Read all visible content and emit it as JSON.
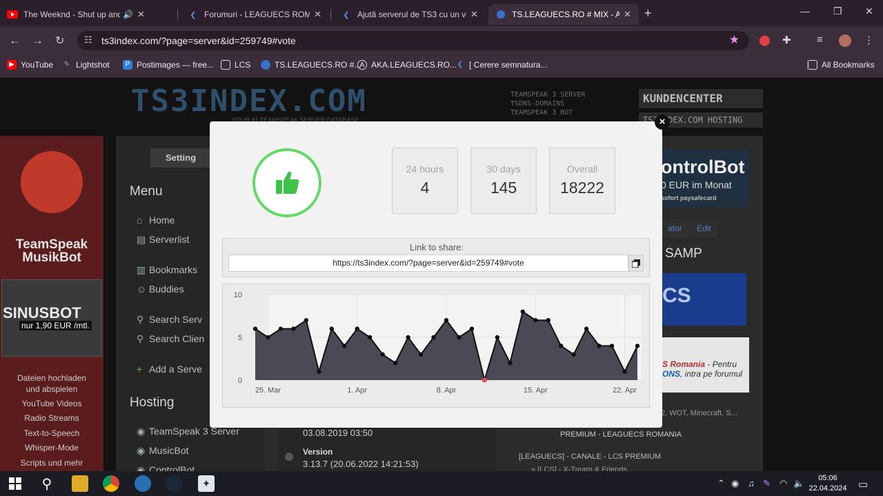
{
  "tabs": [
    {
      "title": "The Weeknd - Shut up and",
      "favicon": "youtube-icon"
    },
    {
      "title": "Forumuri - LEAGUECS ROMAN",
      "favicon": "forum-icon"
    },
    {
      "title": "Ajută serverul de TS3 cu un vo",
      "favicon": "forum-icon"
    },
    {
      "title": "TS.LEAGUECS.RO # MIX - AREA",
      "favicon": "globe-icon"
    }
  ],
  "address_bar": {
    "url": "ts3index.com/?page=server&id=259749#vote"
  },
  "bookmarks": [
    {
      "label": "YouTube"
    },
    {
      "label": "Lightshot"
    },
    {
      "label": "Postimages — free..."
    },
    {
      "label": "LCS"
    },
    {
      "label": "TS.LEAGUECS.RO #..."
    },
    {
      "label": "AKA.LEAGUECS.RO..."
    },
    {
      "label": "[ Cerere semnatura..."
    }
  ],
  "all_bookmarks": "All Bookmarks",
  "site": {
    "logo": "TS3INDEX.COM",
    "tagline": "YOUR #1 TEAMSPEAK SERVER DATABASE",
    "header_services": [
      "TEAMSPEAK 3 SERVER",
      "TSDNS-DOMAINS",
      "TEAMSPEAK 3 BOT"
    ],
    "kundencenter": "KUNDENCENTER",
    "hosting": "TS3INDEX.COM HOSTING"
  },
  "left_ad": {
    "brand_line1": "TeamSpeak",
    "brand_line2": "MusikBot",
    "product": "SINUSBOT",
    "price": "nur 1,90 EUR /mtl.",
    "features": [
      "Dateien hochladen",
      "und abspielen",
      "YouTube Videos",
      "Radio Streams",
      "Text-to-Speech",
      "Whisper-Mode",
      "Scripts und mehr"
    ]
  },
  "sidebar": {
    "settings": "Setting",
    "menu_title": "Menu",
    "menu_items": [
      "Home",
      "Serverlist",
      "Bookmarks",
      "Buddies",
      "Search Serv",
      "Search Clien",
      "Add a Serve"
    ],
    "hosting_title": "Hosting",
    "hosting_items": [
      "TeamSpeak 3 Server",
      "MusicBot",
      "ControlBot"
    ]
  },
  "server_info": {
    "date": "03.08.2019 03:50",
    "version_label": "Version",
    "version_value": "3.13.7 (20.06.2022 14:21:53)"
  },
  "right_col": {
    "ad_title": "ontrolBot",
    "ad_sub": "0 EUR  im Monat",
    "ad_pay": "sofort  paysafecard",
    "tab_admin": "ator",
    "tab_edit": "Edit",
    "samp": "SAMP",
    "banner": "CS",
    "promo_line1_red": "S Romania",
    "promo_line1_rest": " - Pentru",
    "promo_line2_blue": "ONS",
    "promo_line2_rest": ", intra pe forumul",
    "games": "2, WOT, Minecraft, S...",
    "premium": "PREMIUM - LEAGUECS ROMANIA",
    "canale": "[LEAGUECS] - CANALE -  LCS PREMIUM",
    "canale_sub": "» [LCS] - X-Tream & Friends"
  },
  "vote_modal": {
    "stats": [
      {
        "label": "24 hours",
        "value": "4"
      },
      {
        "label": "30 days",
        "value": "145"
      },
      {
        "label": "Overall",
        "value": "18222"
      }
    ],
    "share_label": "Link to share:",
    "share_url": "https://ts3index.com/?page=server&id=259749#vote",
    "colors": {
      "vote_green": "#63d96a",
      "chart_fill": "#4a4a57",
      "highlight_point": "#e05050"
    }
  },
  "chart_data": {
    "type": "area",
    "title": "",
    "xlabel": "",
    "ylabel": "",
    "ylim": [
      0,
      10
    ],
    "yticks": [
      0,
      5,
      10
    ],
    "x_tick_labels": [
      "25. Mar",
      "1. Apr",
      "8. Apr",
      "15. Apr",
      "22. Apr"
    ],
    "x": [
      "24. Mar",
      "25. Mar",
      "26. Mar",
      "27. Mar",
      "28. Mar",
      "29. Mar",
      "30. Mar",
      "31. Mar",
      "1. Apr",
      "2. Apr",
      "3. Apr",
      "4. Apr",
      "5. Apr",
      "6. Apr",
      "7. Apr",
      "8. Apr",
      "9. Apr",
      "10. Apr",
      "11. Apr",
      "12. Apr",
      "13. Apr",
      "14. Apr",
      "15. Apr",
      "16. Apr",
      "17. Apr",
      "18. Apr",
      "19. Apr",
      "20. Apr",
      "21. Apr",
      "22. Apr",
      "23. Apr"
    ],
    "values": [
      6,
      5,
      6,
      6,
      7,
      1,
      6,
      4,
      6,
      5,
      3,
      2,
      5,
      3,
      5,
      7,
      5,
      6,
      0,
      5,
      2,
      8,
      7,
      7,
      4,
      3,
      6,
      4,
      4,
      1,
      4
    ],
    "highlight_index": 18,
    "grid": true,
    "legend": "none"
  },
  "taskbar": {
    "time": "05:06",
    "date": "22.04.2024"
  }
}
